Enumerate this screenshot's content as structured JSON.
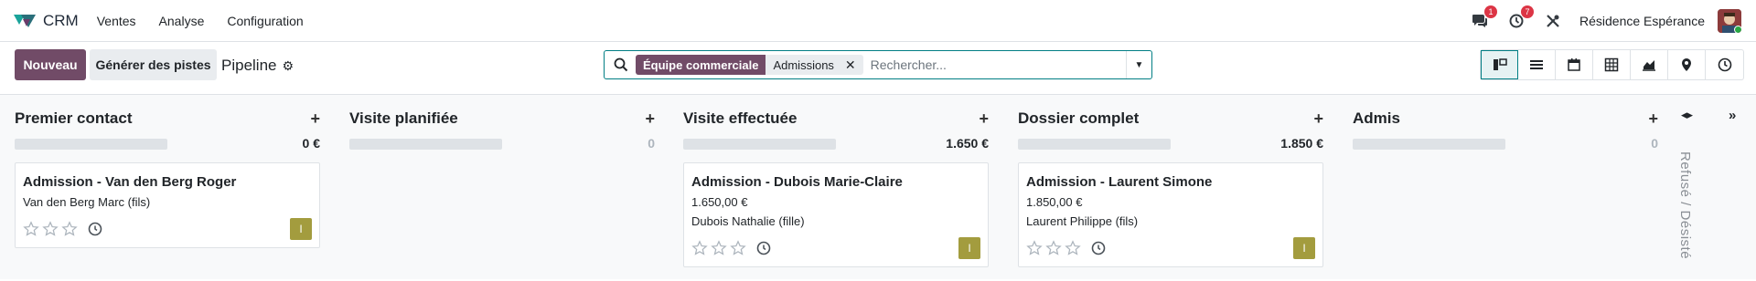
{
  "navbar": {
    "app_name": "CRM",
    "menu": [
      "Ventes",
      "Analyse",
      "Configuration"
    ],
    "messages_count": "1",
    "activities_count": "7",
    "company": "Résidence Espérance"
  },
  "controls": {
    "new_label": "Nouveau",
    "generate_label": "Générer des pistes",
    "breadcrumb": "Pipeline",
    "search": {
      "facet_label": "Équipe commerciale",
      "facet_value": "Admissions",
      "placeholder": "Rechercher..."
    },
    "views": [
      "kanban-icon",
      "list-icon",
      "calendar-icon",
      "pivot-icon",
      "graph-icon",
      "map-icon",
      "activity-icon"
    ],
    "active_view": "kanban-icon"
  },
  "accent_color": "#714B67",
  "columns": [
    {
      "title": "Premier contact",
      "total": "0 €",
      "cards": [
        {
          "title": "Admission - Van den Berg Roger",
          "amount": "",
          "contact": "Van den Berg Marc (fils)",
          "tag": "I"
        }
      ]
    },
    {
      "title": "Visite planifiée",
      "total": "0",
      "cards": []
    },
    {
      "title": "Visite effectuée",
      "total": "1.650 €",
      "cards": [
        {
          "title": "Admission - Dubois Marie-Claire",
          "amount": "1.650,00 €",
          "contact": "Dubois Nathalie (fille)",
          "tag": "I"
        }
      ]
    },
    {
      "title": "Dossier complet",
      "total": "1.850 €",
      "cards": [
        {
          "title": "Admission - Laurent Simone",
          "amount": "1.850,00 €",
          "contact": "Laurent Philippe (fils)",
          "tag": "I"
        }
      ]
    },
    {
      "title": "Admis",
      "total": "0",
      "cards": []
    }
  ],
  "folded_column": {
    "label": "Refusé / Désisté"
  }
}
